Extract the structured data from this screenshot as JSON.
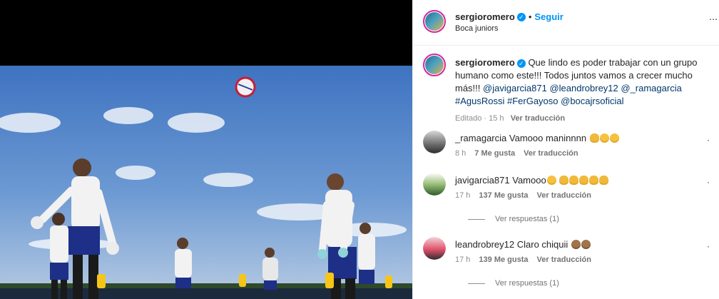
{
  "post": {
    "author": "sergioromero",
    "follow_label": "Seguir",
    "location": "Boca juniors",
    "caption_text": "Que lindo es poder trabajar con un grupo humano como este!!! Todos juntos vamos a crecer mucho más!!!",
    "caption_tags": "@javigarcia871 @leandrobrey12 @_ramagarcia #AgusRossi #FerGayoso @bocajrsoficial",
    "edited_label": "Editado",
    "time": "15 h",
    "translate_label": "Ver traducción"
  },
  "comments": [
    {
      "user": "_ramagarcia",
      "text": "Vamooo maninnnn",
      "emojis": [
        "thumbs-up-emoji",
        "grin-emoji",
        "grin-emoji"
      ],
      "time": "8 h",
      "likes": "7 Me gusta",
      "translate": "Ver traducción",
      "replies": ""
    },
    {
      "user": "javigarcia871",
      "text": "Vamooo",
      "emojis": [
        "grin-emoji",
        "clap-emoji",
        "clap-emoji",
        "clap-emoji",
        "muscle-emoji",
        "muscle-emoji"
      ],
      "time": "17 h",
      "likes": "137 Me gusta",
      "translate": "Ver traducción",
      "replies": "Ver respuestas (1)"
    },
    {
      "user": "leandrobrey12",
      "text": "Claro chiquii",
      "emojis": [
        "clap-emoji",
        "clap-emoji"
      ],
      "time": "17 h",
      "likes": "139 Me gusta",
      "translate": "Ver traducción",
      "replies": "Ver respuestas (1)"
    }
  ],
  "colors": {
    "accent": "#0095f6",
    "link": "#00376b",
    "muted": "#8e8e8e"
  }
}
